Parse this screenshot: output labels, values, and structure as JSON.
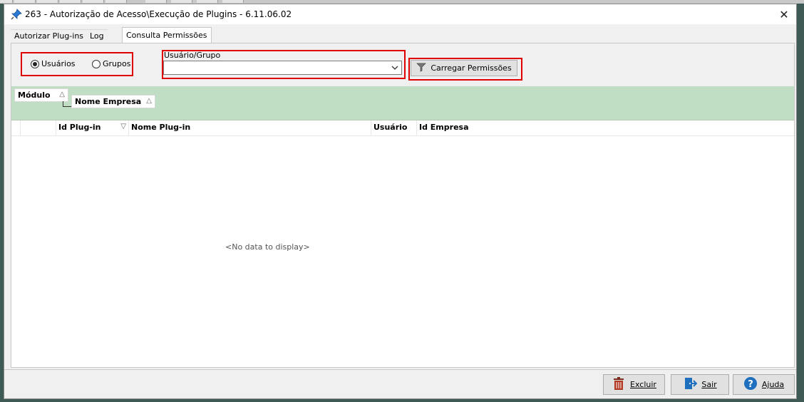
{
  "window": {
    "title": "263 - Autorização de Acesso\\Execução de Plugins - 6.11.06.02"
  },
  "tabs": [
    {
      "label": "Autorizar Plug-ins",
      "active": false
    },
    {
      "label": "Log",
      "active": false
    },
    {
      "label": "Consulta Permissões",
      "active": true
    }
  ],
  "filter": {
    "radio_users_label": "Usuários",
    "radio_groups_label": "Grupos",
    "selected": "Usuários",
    "user_group_label": "Usuário/Grupo",
    "user_group_value": "",
    "load_button_label": "Carregar Permissões"
  },
  "grid": {
    "group_by": [
      {
        "label": "Módulo",
        "sort": "△"
      },
      {
        "label": "Nome Empresa",
        "sort": "△"
      }
    ],
    "columns": [
      {
        "label": "Id Plug-in",
        "sort": "▽"
      },
      {
        "label": "Nome Plug-in",
        "sort": ""
      },
      {
        "label": "Usuário",
        "sort": ""
      },
      {
        "label": "Id Empresa",
        "sort": ""
      }
    ],
    "empty_text": "<No data to display>"
  },
  "footer": {
    "delete_label": "Excluir",
    "exit_label": "Sair",
    "help_label": "Ajuda"
  },
  "colors": {
    "highlight": "#e00000",
    "group_panel": "#c0dec4"
  }
}
